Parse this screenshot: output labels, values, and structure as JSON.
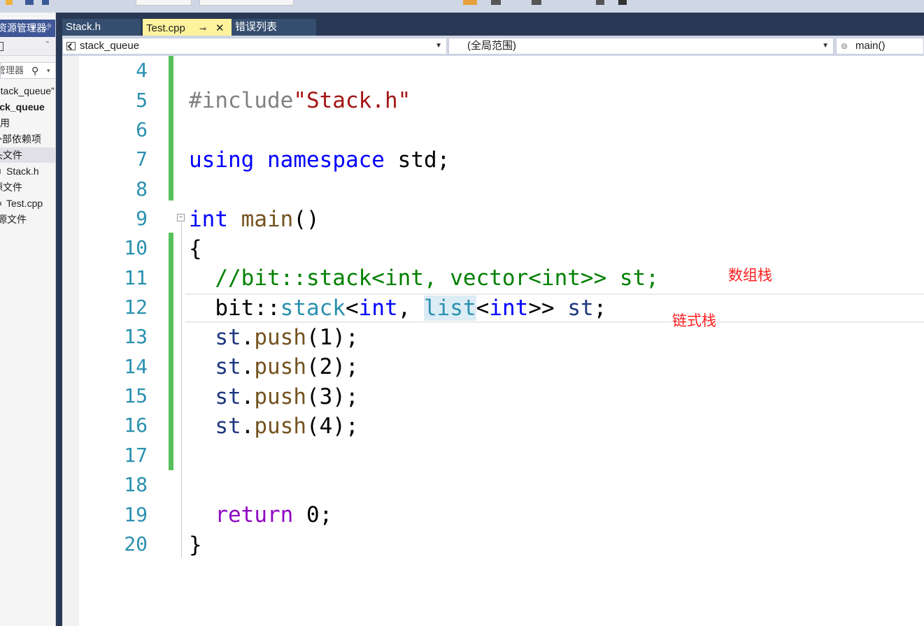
{
  "explorer": {
    "header": "解决方案资源管理器",
    "search_placeholder": "搜索解决方案资源管理器",
    "items": [
      {
        "label": "解决方案“stack_queue”"
      },
      {
        "label": "stack_queue"
      },
      {
        "label": "引用"
      },
      {
        "label": "外部依赖项"
      },
      {
        "label": "头文件"
      },
      {
        "label": "Stack.h"
      },
      {
        "label": "源文件"
      },
      {
        "label": "Test.cpp"
      },
      {
        "label": "资源文件"
      }
    ]
  },
  "tabs": [
    {
      "label": "Stack.h"
    },
    {
      "label": "Test.cpp"
    },
    {
      "label": "错误列表"
    }
  ],
  "navbar": {
    "project": "stack_queue",
    "scope": "(全局范围)",
    "member": "main()"
  },
  "editor": {
    "line_numbers": [
      "4",
      "5",
      "6",
      "7",
      "8",
      "9",
      "10",
      "11",
      "12",
      "13",
      "14",
      "15",
      "16",
      "17",
      "18",
      "19",
      "20"
    ],
    "code": {
      "l5_pp": "#include",
      "l5_str": "\"Stack.h\"",
      "l7_kw1": "using",
      "l7_kw2": "namespace",
      "l7_rest": "std;",
      "l9_kw": "int",
      "l9_fn": "main",
      "l9_rest": "()",
      "l10": "{",
      "l11": "//bit::stack<int, vector<int>> st;",
      "l12_a": "bit::",
      "l12_ty": "stack",
      "l12_b": "<",
      "l12_kw": "int",
      "l12_c": ", ",
      "l12_ty2": "list",
      "l12_d": "<",
      "l12_kw2": "int",
      "l12_e": ">> ",
      "l12_var": "st",
      "l12_f": ";",
      "push_var": "st",
      "push_dot": ".",
      "push_fn": "push",
      "l13_args": "(1);",
      "l14_args": "(2);",
      "l15_args": "(3);",
      "l16_args": "(4);",
      "l19_kw": "return",
      "l19_rest": " 0;",
      "l20": "}"
    },
    "annotations": {
      "array_stack": "数组栈",
      "linked_stack": "链式栈"
    }
  }
}
